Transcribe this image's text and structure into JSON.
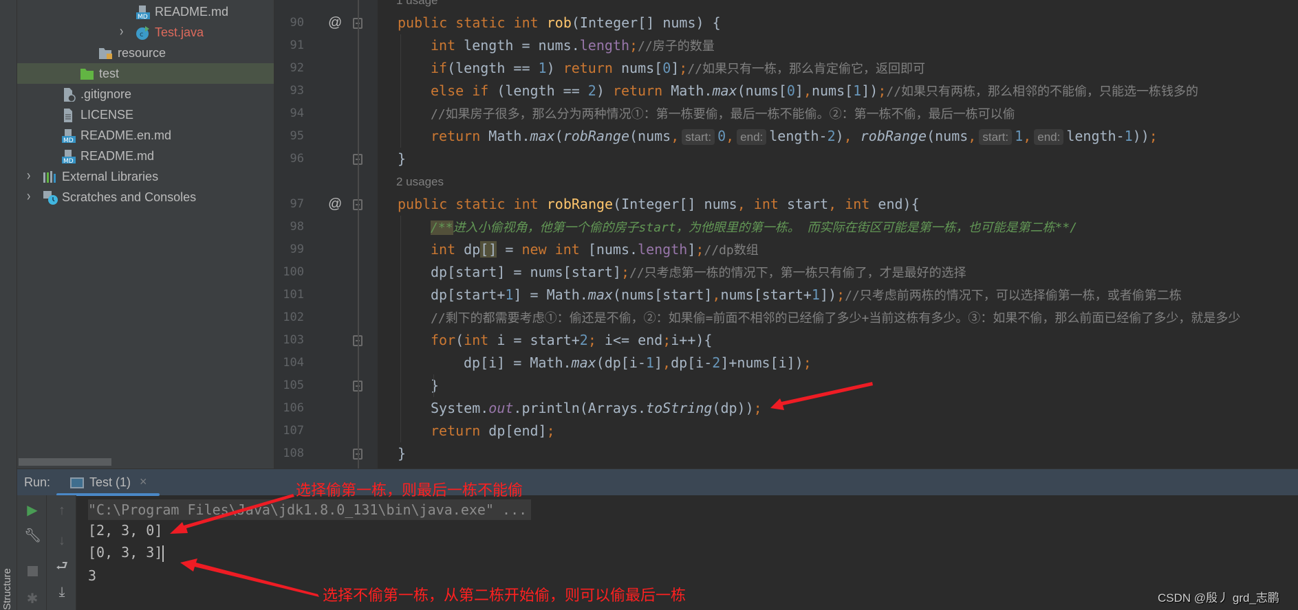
{
  "sidebar": {
    "items": [
      {
        "label": "README.md",
        "icon": "markdown-file-icon",
        "depth": 5,
        "chevron": false,
        "color": "#bbbbbb"
      },
      {
        "label": "Test.java",
        "icon": "java-class-icon",
        "depth": 5,
        "chevron": true,
        "color": "#de6a5c"
      },
      {
        "label": "resource",
        "icon": "resource-folder-icon",
        "depth": 3,
        "chevron": false,
        "color": "#bbbbbb"
      },
      {
        "label": "test",
        "icon": "test-folder-icon",
        "depth": 2,
        "chevron": false,
        "color": "#bbbbbb",
        "selected": true
      },
      {
        "label": ".gitignore",
        "icon": "gitignore-file-icon",
        "depth": 1,
        "chevron": false,
        "color": "#bbbbbb"
      },
      {
        "label": "LICENSE",
        "icon": "text-file-icon",
        "depth": 1,
        "chevron": false,
        "color": "#bbbbbb"
      },
      {
        "label": "README.en.md",
        "icon": "markdown-file-icon",
        "depth": 1,
        "chevron": false,
        "color": "#bbbbbb"
      },
      {
        "label": "README.md",
        "icon": "markdown-file-icon",
        "depth": 1,
        "chevron": false,
        "color": "#bbbbbb"
      },
      {
        "label": "External Libraries",
        "icon": "library-icon",
        "depth": 0,
        "chevron": true,
        "color": "#bbbbbb"
      },
      {
        "label": "Scratches and Consoles",
        "icon": "scratches-icon",
        "depth": 0,
        "chevron": true,
        "color": "#bbbbbb"
      }
    ]
  },
  "editor": {
    "rows": [
      {
        "usage": "1 usage"
      },
      {
        "num": "90",
        "indent": 0,
        "override": true,
        "fold": true,
        "tokens": [
          {
            "t": "public static int ",
            "c": "kw"
          },
          {
            "t": "rob",
            "c": "fn"
          },
          {
            "t": "(Integer[] nums) {",
            "c": ""
          }
        ]
      },
      {
        "num": "91",
        "indent": 1,
        "tokens": [
          {
            "t": "int ",
            "c": "kw"
          },
          {
            "t": "length = nums.",
            "c": ""
          },
          {
            "t": "length",
            "c": "fld"
          },
          {
            "t": ";",
            "c": "kw"
          },
          {
            "t": "//房子的数量",
            "c": "cmt"
          }
        ]
      },
      {
        "num": "92",
        "indent": 1,
        "tokens": [
          {
            "t": "if",
            "c": "kw"
          },
          {
            "t": "(length == ",
            "c": ""
          },
          {
            "t": "1",
            "c": "num"
          },
          {
            "t": ") ",
            "c": ""
          },
          {
            "t": "return ",
            "c": "kw"
          },
          {
            "t": "nums[",
            "c": ""
          },
          {
            "t": "0",
            "c": "num"
          },
          {
            "t": "]",
            "c": ""
          },
          {
            "t": ";",
            "c": "kw"
          },
          {
            "t": "//如果只有一栋，那么肯定偷它，返回即可",
            "c": "cmt"
          }
        ]
      },
      {
        "num": "93",
        "indent": 1,
        "tokens": [
          {
            "t": "else if ",
            "c": "kw"
          },
          {
            "t": "(length == ",
            "c": ""
          },
          {
            "t": "2",
            "c": "num"
          },
          {
            "t": ") ",
            "c": ""
          },
          {
            "t": "return ",
            "c": "kw"
          },
          {
            "t": "Math.",
            "c": ""
          },
          {
            "t": "max",
            "c": "it"
          },
          {
            "t": "(nums[",
            "c": ""
          },
          {
            "t": "0",
            "c": "num"
          },
          {
            "t": "]",
            "c": ""
          },
          {
            "t": ",",
            "c": "kw"
          },
          {
            "t": "nums[",
            "c": ""
          },
          {
            "t": "1",
            "c": "num"
          },
          {
            "t": "])",
            "c": ""
          },
          {
            "t": ";",
            "c": "kw"
          },
          {
            "t": "//如果只有两栋，那么相邻的不能偷，只能选一栋钱多的",
            "c": "cmt"
          }
        ]
      },
      {
        "num": "94",
        "indent": 1,
        "tokens": [
          {
            "t": "//如果房子很多，那么分为两种情况①：第一栋要偷，最后一栋不能偷。②：第一栋不偷，最后一栋可以偷",
            "c": "cmt"
          }
        ]
      },
      {
        "num": "95",
        "indent": 1,
        "tokens": [
          {
            "t": "return ",
            "c": "kw"
          },
          {
            "t": "Math.",
            "c": ""
          },
          {
            "t": "max",
            "c": "it"
          },
          {
            "t": "(",
            "c": ""
          },
          {
            "t": "robRange",
            "c": "it"
          },
          {
            "t": "(nums",
            "c": ""
          },
          {
            "t": ",",
            "c": "kw"
          },
          {
            "t": "start:",
            "c": "hint"
          },
          {
            "t": "0",
            "c": "num"
          },
          {
            "t": ",",
            "c": "kw"
          },
          {
            "t": "end:",
            "c": "hint"
          },
          {
            "t": "length-",
            "c": ""
          },
          {
            "t": "2",
            "c": "num"
          },
          {
            "t": ")",
            "c": ""
          },
          {
            "t": ", ",
            "c": "kw"
          },
          {
            "t": "robRange",
            "c": "it"
          },
          {
            "t": "(nums",
            "c": ""
          },
          {
            "t": ",",
            "c": "kw"
          },
          {
            "t": "start:",
            "c": "hint"
          },
          {
            "t": "1",
            "c": "num"
          },
          {
            "t": ",",
            "c": "kw"
          },
          {
            "t": "end:",
            "c": "hint"
          },
          {
            "t": "length-",
            "c": ""
          },
          {
            "t": "1",
            "c": "num"
          },
          {
            "t": "))",
            "c": ""
          },
          {
            "t": ";",
            "c": "kw"
          }
        ]
      },
      {
        "num": "96",
        "indent": 0,
        "fold": true,
        "tokens": [
          {
            "t": "}",
            "c": ""
          }
        ]
      },
      {
        "usage": "2 usages"
      },
      {
        "num": "97",
        "indent": 0,
        "override": true,
        "fold": true,
        "tokens": [
          {
            "t": "public static int ",
            "c": "kw"
          },
          {
            "t": "robRange",
            "c": "fn"
          },
          {
            "t": "(Integer[] nums",
            "c": ""
          },
          {
            "t": ", int ",
            "c": "kw"
          },
          {
            "t": "start",
            "c": ""
          },
          {
            "t": ", int ",
            "c": "kw"
          },
          {
            "t": "end){",
            "c": ""
          }
        ]
      },
      {
        "num": "98",
        "indent": 1,
        "tokens": [
          {
            "t": "/**",
            "c": "doc hl"
          },
          {
            "t": "进入小偷视角，他第一个偷的房子start，为他眼里的第一栋。 而实际在街区可能是第一栋，也可能是第二栋**/",
            "c": "doc"
          }
        ]
      },
      {
        "num": "99",
        "indent": 1,
        "tokens": [
          {
            "t": "int ",
            "c": "kw"
          },
          {
            "t": "dp",
            "c": ""
          },
          {
            "t": "[]",
            "c": "hl"
          },
          {
            "t": " = ",
            "c": ""
          },
          {
            "t": "new int ",
            "c": "kw"
          },
          {
            "t": "[nums.",
            "c": ""
          },
          {
            "t": "length",
            "c": "fld"
          },
          {
            "t": "]",
            "c": ""
          },
          {
            "t": ";",
            "c": "kw"
          },
          {
            "t": "//dp数组",
            "c": "cmt"
          }
        ]
      },
      {
        "num": "100",
        "indent": 1,
        "tokens": [
          {
            "t": "dp[start] = nums[start]",
            "c": ""
          },
          {
            "t": ";",
            "c": "kw"
          },
          {
            "t": "//只考虑第一栋的情况下，第一栋只有偷了，才是最好的选择",
            "c": "cmt"
          }
        ]
      },
      {
        "num": "101",
        "indent": 1,
        "tokens": [
          {
            "t": "dp[start+",
            "c": ""
          },
          {
            "t": "1",
            "c": "num"
          },
          {
            "t": "] = Math.",
            "c": ""
          },
          {
            "t": "max",
            "c": "it"
          },
          {
            "t": "(nums[start]",
            "c": ""
          },
          {
            "t": ",",
            "c": "kw"
          },
          {
            "t": "nums[start+",
            "c": ""
          },
          {
            "t": "1",
            "c": "num"
          },
          {
            "t": "])",
            "c": ""
          },
          {
            "t": ";",
            "c": "kw"
          },
          {
            "t": "//只考虑前两栋的情况下，可以选择偷第一栋，或者偷第二栋",
            "c": "cmt"
          }
        ]
      },
      {
        "num": "102",
        "indent": 1,
        "tokens": [
          {
            "t": "//剩下的都需要考虑①：偷还是不偷，②：如果偷=前面不相邻的已经偷了多少+当前这栋有多少。③：如果不偷，那么前面已经偷了多少，就是多少",
            "c": "cmt"
          }
        ]
      },
      {
        "num": "103",
        "indent": 1,
        "fold": true,
        "tokens": [
          {
            "t": "for",
            "c": "kw"
          },
          {
            "t": "(",
            "c": ""
          },
          {
            "t": "int ",
            "c": "kw"
          },
          {
            "t": "i = start+",
            "c": ""
          },
          {
            "t": "2",
            "c": "num"
          },
          {
            "t": "; ",
            "c": "kw"
          },
          {
            "t": "i<= end",
            "c": ""
          },
          {
            "t": ";",
            "c": "kw"
          },
          {
            "t": "i++){",
            "c": ""
          }
        ]
      },
      {
        "num": "104",
        "indent": 2,
        "tokens": [
          {
            "t": "dp[i] = Math.",
            "c": ""
          },
          {
            "t": "max",
            "c": "it"
          },
          {
            "t": "(dp[i-",
            "c": ""
          },
          {
            "t": "1",
            "c": "num"
          },
          {
            "t": "]",
            "c": ""
          },
          {
            "t": ",",
            "c": "kw"
          },
          {
            "t": "dp[i-",
            "c": ""
          },
          {
            "t": "2",
            "c": "num"
          },
          {
            "t": "]+nums[i])",
            "c": ""
          },
          {
            "t": ";",
            "c": "kw"
          }
        ]
      },
      {
        "num": "105",
        "indent": 1,
        "fold": true,
        "tokens": [
          {
            "t": "}",
            "c": ""
          }
        ]
      },
      {
        "num": "106",
        "indent": 1,
        "tokens": [
          {
            "t": "System.",
            "c": ""
          },
          {
            "t": "out",
            "c": "fldit"
          },
          {
            "t": ".println(Arrays.",
            "c": ""
          },
          {
            "t": "toString",
            "c": "it"
          },
          {
            "t": "(dp))",
            "c": ""
          },
          {
            "t": ";",
            "c": "kw"
          }
        ]
      },
      {
        "num": "107",
        "indent": 1,
        "tokens": [
          {
            "t": "return ",
            "c": "kw"
          },
          {
            "t": "dp[end]",
            "c": ""
          },
          {
            "t": ";",
            "c": "kw"
          }
        ]
      },
      {
        "num": "108",
        "indent": 0,
        "fold": true,
        "tokens": [
          {
            "t": "}",
            "c": ""
          }
        ]
      }
    ]
  },
  "run": {
    "label": "Run:",
    "tab_label": "Test (1)",
    "close": "×",
    "console": [
      "\"C:\\Program Files\\Java\\jdk1.8.0_131\\bin\\java.exe\" ...",
      "[2, 3, 0]",
      "[0, 3, 3]",
      "3"
    ],
    "toolbar_left": [
      "run-icon",
      "wrench-icon",
      "stop-icon",
      "debug-icon"
    ],
    "toolbar_right": [
      "up-arrow-icon",
      "down-arrow-icon",
      "soft-wrap-icon",
      "scroll-to-end-icon"
    ]
  },
  "side_tab": "Structure",
  "annotations": {
    "first": "选择偷第一栋，则最后一栋不能偷",
    "second": "选择不偷第一栋，从第二栋开始偷，则可以偷最后一栋",
    "color": "#ff2020"
  },
  "watermark": "CSDN @殷丿 grd_志鹏",
  "colors": {
    "keyword": "#cc7832",
    "number": "#6897bb",
    "comment": "#808080",
    "doc_comment": "#629755",
    "method": "#ffc66d",
    "field": "#9876aa"
  }
}
